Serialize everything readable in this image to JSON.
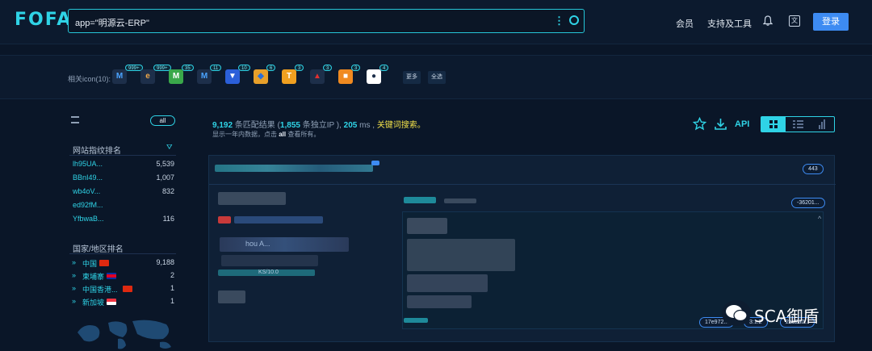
{
  "header": {
    "logo": "FOFA",
    "search_query": "app=\"明源云-ERP\"",
    "nav": [
      "会员",
      "支持及工具"
    ],
    "login": "登录",
    "translate_glyph": "文"
  },
  "related_icons": {
    "label": "相关icon(10):",
    "items": [
      {
        "glyph": "M",
        "count": "999+",
        "bg": "#1d2f4a",
        "fg": "#4aa3ff"
      },
      {
        "glyph": "e",
        "count": "999+",
        "bg": "#1d2f4a",
        "fg": "#f0a84a"
      },
      {
        "glyph": "M",
        "count": "35",
        "bg": "#3aa84a",
        "fg": "#ffffff"
      },
      {
        "glyph": "M",
        "count": "11",
        "bg": "#1d2f4a",
        "fg": "#4aa3ff"
      },
      {
        "glyph": "▼",
        "count": "10",
        "bg": "#2b5fd9",
        "fg": "#ffffff"
      },
      {
        "glyph": "◆",
        "count": "6",
        "bg": "#e8a02a",
        "fg": "#2a6fd9"
      },
      {
        "glyph": "T",
        "count": "3",
        "bg": "#f0a020",
        "fg": "#ffffff"
      },
      {
        "glyph": "▲",
        "count": "3",
        "bg": "#1d2f4a",
        "fg": "#e03030"
      },
      {
        "glyph": "■",
        "count": "3",
        "bg": "#f08a20",
        "fg": "#ffffff"
      },
      {
        "glyph": "●",
        "count": "4",
        "bg": "#ffffff",
        "fg": "#1d2f4a"
      }
    ],
    "more": "更多",
    "select_all": "全选"
  },
  "sidebar": {
    "all_button": "all",
    "fingerprint_title": "网站指纹排名",
    "fingerprints": [
      {
        "key": "lh95UA...",
        "value": "5,539"
      },
      {
        "key": "BBnI49...",
        "value": "1,007"
      },
      {
        "key": "wb4oV...",
        "value": "832"
      },
      {
        "key": "ed92fM...",
        "value": ""
      },
      {
        "key": "YfbwaB...",
        "value": "116"
      }
    ],
    "country_title": "国家/地区排名",
    "countries": [
      {
        "name": "中国",
        "value": "9,188"
      },
      {
        "name": "柬埔寨",
        "value": "2"
      },
      {
        "name": "中国香港...",
        "value": "1"
      },
      {
        "name": "新加坡",
        "value": "1"
      }
    ]
  },
  "results": {
    "count": "9,192",
    "count_label": "条匹配结果 (",
    "ip_count": "1,855",
    "ip_label": "条独立IP ),",
    "ms": "205",
    "ms_label": "ms ,",
    "keyword": "关键词搜索。",
    "line2_prefix": "显示一年内数据，点击",
    "line2_all": "all",
    "line2_suffix": "查看所有。",
    "api": "API",
    "card": {
      "badge": "443",
      "tag_top": "-36201...",
      "tags_bottom": [
        "17e972...",
        "3:1.2",
        "2ad2a0..."
      ],
      "protocol_snippet": "KS/10.0",
      "host_snippet": "hou A..."
    }
  },
  "watermark": "SCA御盾"
}
